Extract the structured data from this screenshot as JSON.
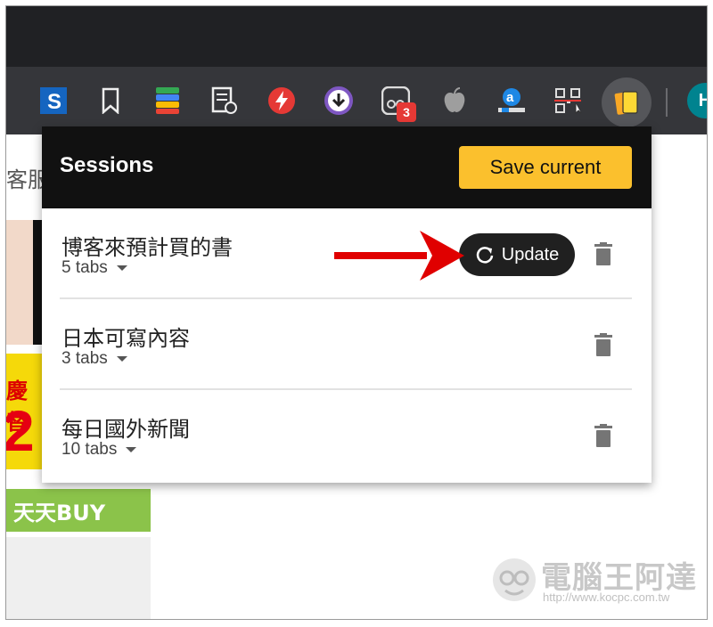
{
  "page": {
    "left_text": "客服"
  },
  "toolbar": {
    "extensions": [
      {
        "icon": "s-icon"
      },
      {
        "icon": "bookmark-icon"
      },
      {
        "icon": "color-stack-icon"
      },
      {
        "icon": "document-icon"
      },
      {
        "icon": "lightning-icon"
      },
      {
        "icon": "download-circle-icon"
      },
      {
        "icon": "ghost-extension-icon",
        "badge": "3"
      },
      {
        "icon": "apple-icon"
      },
      {
        "icon": "amazon-icon"
      },
      {
        "icon": "qr-code-icon"
      },
      {
        "icon": "sessions-extension-icon"
      }
    ],
    "avatar_letter": "H"
  },
  "ads": {
    "yellow_text": "慶替",
    "yellow_number": "2",
    "green_text": "天天BUY"
  },
  "popup": {
    "title": "Sessions",
    "save_label": "Save current",
    "update_label": "Update",
    "sessions": [
      {
        "name": "博客來預計買的書",
        "tabs": "5 tabs"
      },
      {
        "name": "日本可寫內容",
        "tabs": "3 tabs"
      },
      {
        "name": "每日國外新聞",
        "tabs": "10 tabs"
      }
    ]
  },
  "watermark": {
    "name": "電腦王阿達",
    "url": "http://www.kocpc.com.tw"
  },
  "colors": {
    "accent": "#fbc02d",
    "arrow": "#e00000",
    "header": "#111111"
  }
}
